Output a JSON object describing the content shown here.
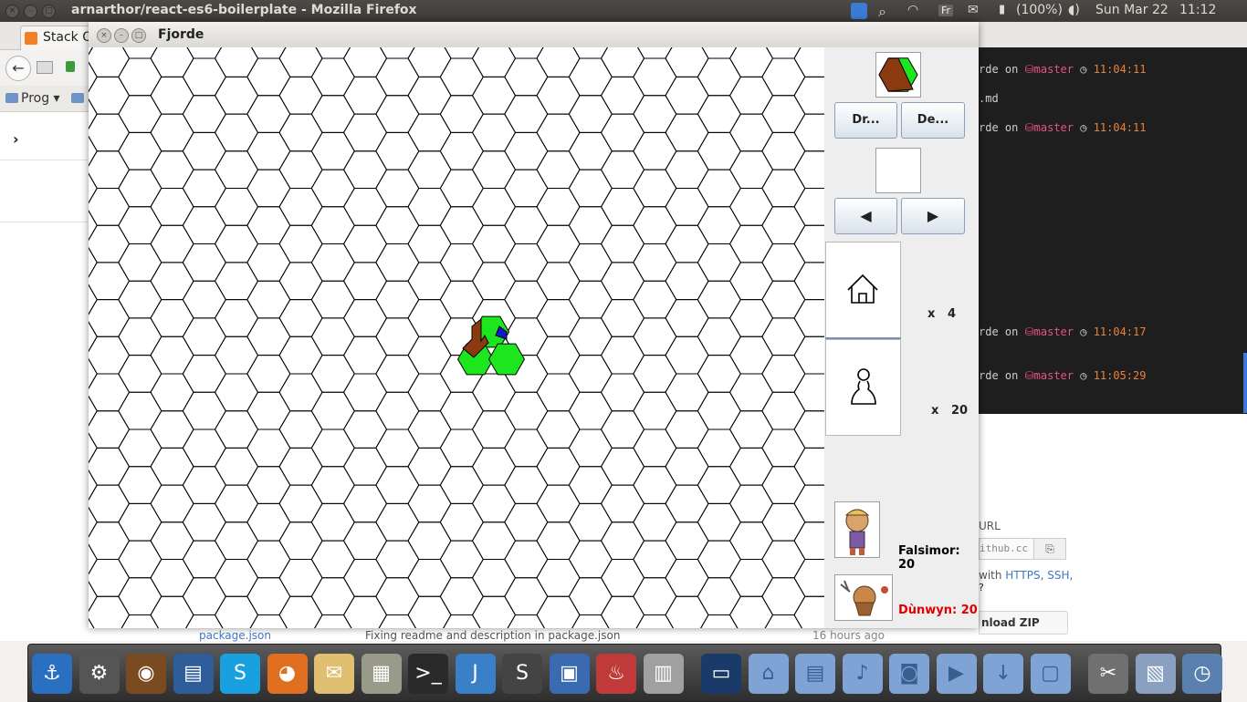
{
  "system_bar": {
    "window_title": "arnarthor/react-es6-boilerplate - Mozilla Firefox",
    "keyboard_layout": "Fr",
    "battery": "(100%)",
    "date": "Sun Mar 22",
    "time": "11:12"
  },
  "firefox": {
    "tab_label": "Stack O",
    "bookmark_folder": "Prog ▾",
    "sidebar_chevron": "›"
  },
  "terminal": {
    "lines": [
      {
        "prefix": "rde on ",
        "branch_icon": "⛁",
        "branch": "master",
        "clock": " ◷ ",
        "time": "11:04:11"
      },
      {
        "text": ".md"
      },
      {
        "prefix": "rde on ",
        "branch_icon": "⛁",
        "branch": "master",
        "clock": " ◷ ",
        "time": "11:04:11"
      },
      {
        "prefix": "rde on ",
        "branch_icon": "⛁",
        "branch": "master",
        "clock": " ◷ ",
        "time": "11:04:17"
      },
      {
        "prefix": "rde on ",
        "branch_icon": "⛁",
        "branch": "master",
        "clock": " ◷ ",
        "time": "11:05:29"
      }
    ]
  },
  "github": {
    "url_label": "URL",
    "clone_input": "ithub.cc",
    "clone_with_prefix": "with ",
    "https_link": "HTTPS",
    "sep": ", ",
    "ssh_link": "SSH",
    "trailing": ",",
    "download_zip": "nload ZIP",
    "file_name": "package.json",
    "commit_msg": "Fixing readme and description in package.json",
    "age": "16 hours ago"
  },
  "fjorde": {
    "title": "Fjorde",
    "draw_button": "Dr...",
    "discard_button": "De...",
    "prev_button": "◀",
    "next_button": "▶",
    "huts_count": "x   4",
    "followers_count": "x   20",
    "players": [
      {
        "name": "Falsimor: 20",
        "color": "#000000"
      },
      {
        "name": "Dùnwyn: 20",
        "color": "#e00000"
      }
    ],
    "colors": {
      "grass": "#1ee61e",
      "mountain": "#8b3a0f",
      "water": "#0a1acc"
    }
  },
  "dock": {
    "icons": [
      "anchor-icon",
      "settings-icon",
      "speaker-icon",
      "document-viewer-icon",
      "skype-icon",
      "firefox-icon",
      "mail-icon",
      "calculator-icon",
      "terminal-icon",
      "intellij-icon",
      "sublime-icon",
      "virtualbox-icon",
      "popcorn-icon",
      "file-cabinet-icon",
      "screen-icon",
      "home-folder-icon",
      "documents-folder-icon",
      "music-folder-icon",
      "pictures-folder-icon",
      "videos-folder-icon",
      "downloads-folder-icon",
      "folder-icon",
      "scissors-icon",
      "screenshot-icon",
      "time-machine-icon"
    ]
  }
}
